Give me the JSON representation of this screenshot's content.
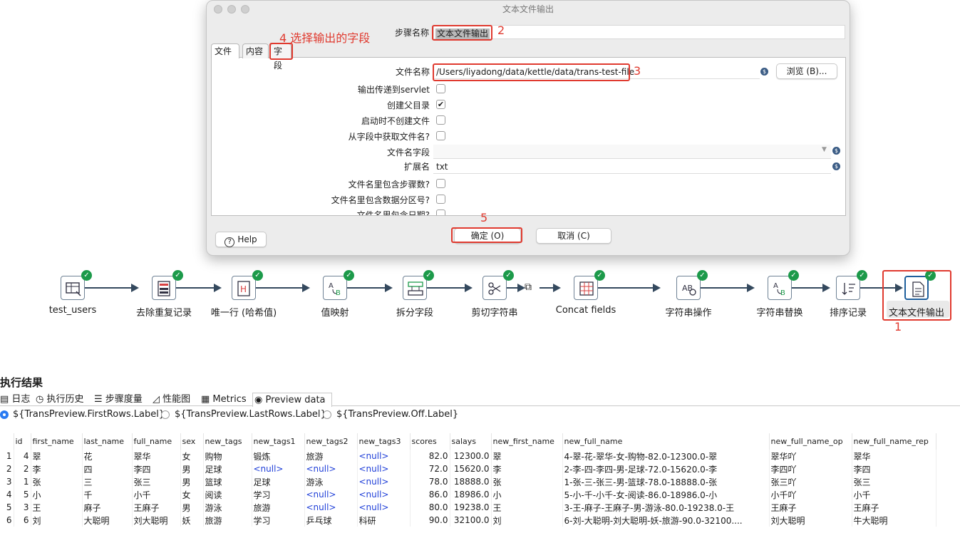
{
  "dialog": {
    "title": "文本文件输出",
    "step_name_label": "步骤名称",
    "step_name_value": "文本文件输出",
    "annotations": {
      "a1": "1",
      "a2": "2",
      "a3": "3",
      "a4": "4 选择输出的字段",
      "a5": "5"
    },
    "tabs": [
      {
        "label": "文件"
      },
      {
        "label": "内容"
      },
      {
        "label": "字段"
      }
    ],
    "fields": {
      "filename_label": "文件名称",
      "filename_value": "/Users/liyadong/data/kettle/data/trans-test-file",
      "browse_label": "浏览 (B)...",
      "servlet_label": "输出传递到servlet",
      "create_parent_label": "创建父目录",
      "no_create_label": "启动时不创建文件",
      "from_field_label": "从字段中获取文件名?",
      "filename_field_label": "文件名字段",
      "filename_field_value": "",
      "extension_label": "扩展名",
      "extension_value": "txt",
      "stepnr_label": "文件名里包含步骤数?",
      "partition_label": "文件名里包含数据分区号?",
      "date_label": "文件名里包含日期?"
    },
    "checkboxes": {
      "servlet": false,
      "create_parent": true,
      "no_create": false,
      "from_field": false,
      "stepnr": false,
      "partition": false,
      "date": false
    },
    "buttons": {
      "help": "Help",
      "ok": "确定 (O)",
      "cancel": "取消 (C)"
    }
  },
  "canvas": {
    "nodes": [
      {
        "label": "test_users",
        "icon": "table-input-icon"
      },
      {
        "label": "去除重复记录",
        "icon": "unique-rows-icon"
      },
      {
        "label": "唯一行 (哈希值)",
        "icon": "unique-hash-icon"
      },
      {
        "label": "值映射",
        "icon": "value-mapper-icon"
      },
      {
        "label": "拆分字段",
        "icon": "split-fields-icon"
      },
      {
        "label": "剪切字符串",
        "icon": "cut-string-icon"
      },
      {
        "label": "Concat fields",
        "icon": "concat-fields-icon"
      },
      {
        "label": "字符串操作",
        "icon": "string-operations-icon"
      },
      {
        "label": "字符串替换",
        "icon": "replace-string-icon"
      },
      {
        "label": "排序记录",
        "icon": "sort-rows-icon"
      },
      {
        "label": "文本文件输出",
        "icon": "text-file-output-icon"
      }
    ]
  },
  "results": {
    "title": "执行结果",
    "tabs": [
      {
        "label": "日志"
      },
      {
        "label": "执行历史"
      },
      {
        "label": "步骤度量"
      },
      {
        "label": "性能图"
      },
      {
        "label": "Metrics"
      },
      {
        "label": "Preview data"
      }
    ],
    "radios": [
      {
        "label": "${TransPreview.FirstRows.Label}",
        "checked": true
      },
      {
        "label": "${TransPreview.LastRows.Label}",
        "checked": false
      },
      {
        "label": "${TransPreview.Off.Label}",
        "checked": false
      }
    ],
    "columns": [
      "",
      "id",
      "first_name",
      "last_name",
      "full_name",
      "sex",
      "new_tags",
      "new_tags1",
      "new_tags2",
      "new_tags3",
      "scores",
      "salays",
      "new_first_name",
      "new_full_name",
      "new_full_name_op",
      "new_full_name_rep"
    ],
    "rows": [
      [
        "1",
        "4",
        "翠",
        "花",
        "翠华",
        "女",
        "购物",
        "锻炼",
        "旅游",
        "<null>",
        "82.0",
        "12300.0",
        "翠",
        "4-翠-花-翠华-女-购物-82.0-12300.0-翠",
        "翠华吖",
        "翠华"
      ],
      [
        "2",
        "2",
        "李",
        "四",
        "李四",
        "男",
        "足球",
        "<null>",
        "<null>",
        "<null>",
        "72.0",
        "15620.0",
        "李",
        "2-李-四-李四-男-足球-72.0-15620.0-李",
        "李四吖",
        "李四"
      ],
      [
        "3",
        "1",
        "张",
        "三",
        "张三",
        "男",
        "篮球",
        "足球",
        "游泳",
        "<null>",
        "78.0",
        "18888.0",
        "张",
        "1-张-三-张三-男-篮球-78.0-18888.0-张",
        "张三吖",
        "张三"
      ],
      [
        "4",
        "5",
        "小",
        "千",
        "小千",
        "女",
        "阅读",
        "学习",
        "<null>",
        "<null>",
        "86.0",
        "18986.0",
        "小",
        "5-小-千-小千-女-阅读-86.0-18986.0-小",
        "小千吖",
        "小千"
      ],
      [
        "5",
        "3",
        "王",
        "麻子",
        "王麻子",
        "男",
        "游泳",
        "旅游",
        "<null>",
        "<null>",
        "80.0",
        "19238.0",
        "王",
        "3-王-麻子-王麻子-男-游泳-80.0-19238.0-王",
        "王麻子",
        "王麻子"
      ],
      [
        "6",
        "6",
        "刘",
        "大聪明",
        "刘大聪明",
        "妖",
        "旅游",
        "学习",
        "乒乓球",
        "科研",
        "90.0",
        "32100.0",
        "刘",
        "6-刘-大聪明-刘大聪明-妖-旅游-90.0-32100....",
        "刘大聪明",
        "牛大聪明"
      ]
    ]
  },
  "colors": {
    "annotation_red": "#e03a2f",
    "ok_green": "#1c9a4a",
    "null_blue": "#1f3fd8",
    "hop": "#34495e"
  }
}
